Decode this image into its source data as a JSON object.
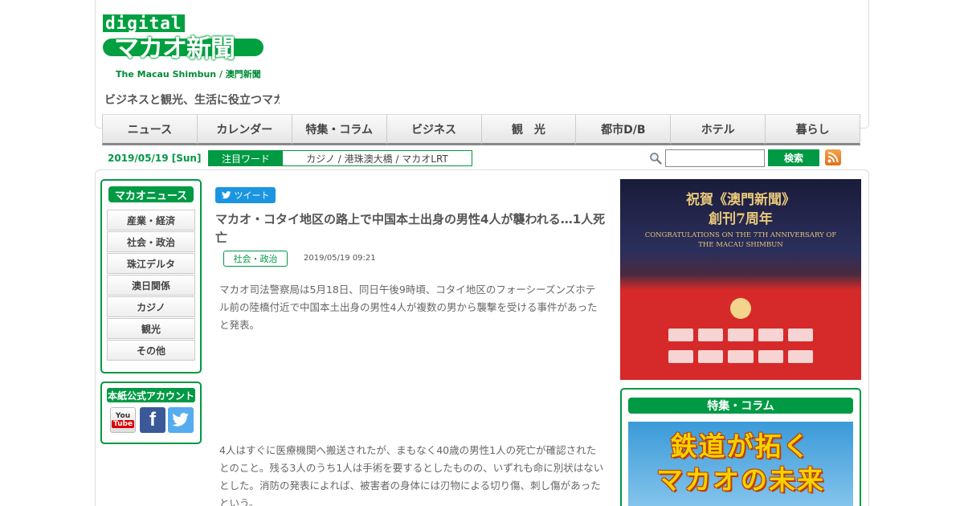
{
  "header": {
    "logo_digital": "digital",
    "logo_main": "マカオ新聞",
    "logo_sub": "The Macau Shimbun / 澳門新聞",
    "tagline": "ビジネスと観光、生活に役立つマカオ情報"
  },
  "nav": {
    "items": [
      "ニュース",
      "カレンダー",
      "特集・コラム",
      "ビジネス",
      "観　光",
      "都市D/B",
      "ホテル",
      "暮らし"
    ]
  },
  "subbar": {
    "date": "2019/05/19 [Sun]",
    "keyword_label": "注目ワード",
    "keywords": "カジノ / 港珠澳大橋 / マカオLRT",
    "search_placeholder": "",
    "search_button": "検索"
  },
  "sidebar": {
    "news_title": "マカオニュース",
    "news_items": [
      "産業・経済",
      "社会・政治",
      "珠江デルタ",
      "澳日関係",
      "カジノ",
      "観光",
      "その他"
    ],
    "account_title": "本紙公式アカウント",
    "youtube_label": "You",
    "youtube_tube": "Tube",
    "facebook_label": "f"
  },
  "article": {
    "tweet_label": "ツイート",
    "title": "マカオ・コタイ地区の路上で中国本土出身の男性4人が襲われる…1人死亡",
    "category": "社会・政治",
    "datetime": "2019/05/19 09:21",
    "paragraph1": "マカオ司法警察局は5月18日、同日午後9時頃、コタイ地区のフォーシーズンズホテル前の陸橋付近で中国本土出身の男性4人が複数の男から襲撃を受ける事件があったと発表。",
    "paragraph2": "4人はすぐに医療機関へ搬送されたが、まもなく40歳の男性1人の死亡が確認されたとのこと。残る3人のうち1人は手術を要するとしたものの、いずれも命に別状はないとした。消防の発表によれば、被害者の身体には刃物による切り傷、刺し傷があったという。"
  },
  "ad": {
    "title_line1": "祝賀《澳門新聞》",
    "title_line2": "創刊7周年",
    "sub_line1": "CONGRATULATIONS ON THE 7TH ANNIVERSARY OF",
    "sub_line2": "THE MACAU SHIMBUN"
  },
  "feature": {
    "title": "特集・コラム",
    "image_line1": "鉄道が拓く",
    "image_line2": "マカオの未来"
  },
  "colors": {
    "brand_green": "#009944",
    "ad_red": "#d62a2a",
    "twitter_blue": "#1b95e0"
  }
}
